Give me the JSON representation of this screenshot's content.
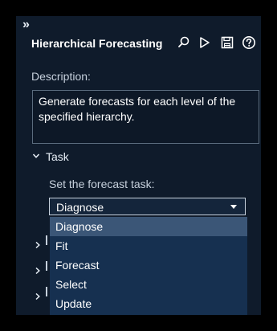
{
  "panel": {
    "collapse_glyph": "»",
    "title": "Hierarchical Forecasting",
    "toolbar_icons": [
      "search-icon",
      "run-icon",
      "save-icon",
      "help-icon"
    ]
  },
  "description": {
    "label": "Description:",
    "text": "Generate forecasts for each level of the specified hierarchy."
  },
  "task_section": {
    "header": "Task",
    "expanded": true,
    "field_label": "Set the forecast task:",
    "selected_value": "Diagnose"
  },
  "dropdown": {
    "options": [
      "Diagnose",
      "Fit",
      "Forecast",
      "Select",
      "Update"
    ],
    "highlighted": "Diagnose"
  },
  "colors": {
    "panel_bg": "#0f1b2b",
    "dropdown_bg": "#163050",
    "highlight_bg": "#3b5677",
    "text": "#ffffff"
  }
}
